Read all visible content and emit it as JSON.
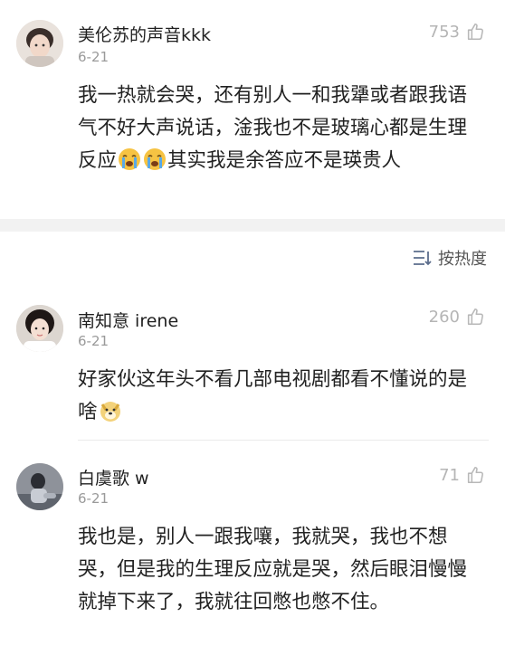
{
  "sort": {
    "label": "按热度"
  },
  "comments": [
    {
      "name": "美伦苏的声音kkk",
      "date": "6-21",
      "likes": "753",
      "text_before": "我一热就会哭，还有别人一和我犟或者跟我语气不好大声说话，淦我也不是玻璃心都是生理反应",
      "emoji": [
        "loudly-crying-face",
        "loudly-crying-face"
      ],
      "text_after": "其实我是余答应不是瑛贵人"
    },
    {
      "name": "南知意 irene",
      "date": "6-21",
      "likes": "260",
      "text_before": "好家伙这年头不看几部电视剧都看不懂说的是啥",
      "emoji": [
        "doge-face"
      ],
      "text_after": ""
    },
    {
      "name": "白虞歌 w",
      "date": "6-21",
      "likes": "71",
      "text_before": "我也是，别人一跟我嚷，我就哭，我也不想哭，但是我的生理反应就是哭，然后眼泪慢慢就掉下来了，我就往回憋也憋不住。",
      "emoji": [],
      "text_after": ""
    }
  ]
}
